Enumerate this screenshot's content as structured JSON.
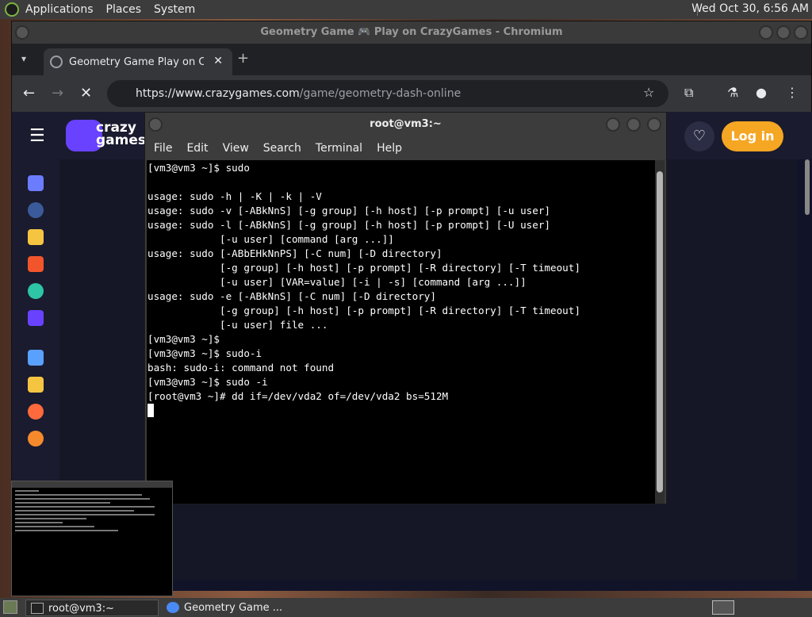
{
  "top_panel": {
    "menus": [
      "Applications",
      "Places",
      "System"
    ],
    "clock": "Wed Oct 30,  6:56 AM"
  },
  "browser": {
    "window_title": "Geometry Game 🎮 Play on CrazyGames - Chromium",
    "tab_title": "Geometry Game   Play on Cr",
    "tab_close": "✕",
    "new_tab": "+",
    "url_host": "https://www.crazygames.com",
    "url_path": "/game/geometry-dash-online",
    "site": {
      "logo_text_1": "crazy",
      "logo_text_2": "games",
      "login_label": "Log in"
    }
  },
  "terminal": {
    "title": "root@vm3:~",
    "menu": [
      "File",
      "Edit",
      "View",
      "Search",
      "Terminal",
      "Help"
    ],
    "lines": [
      "[vm3@vm3 ~]$ sudo",
      "",
      "usage: sudo -h | -K | -k | -V",
      "usage: sudo -v [-ABkNnS] [-g group] [-h host] [-p prompt] [-u user]",
      "usage: sudo -l [-ABkNnS] [-g group] [-h host] [-p prompt] [-U user]",
      "            [-u user] [command [arg ...]]",
      "usage: sudo [-ABbEHkNnPS] [-C num] [-D directory]",
      "            [-g group] [-h host] [-p prompt] [-R directory] [-T timeout]",
      "            [-u user] [VAR=value] [-i | -s] [command [arg ...]]",
      "usage: sudo -e [-ABkNnS] [-C num] [-D directory]",
      "            [-g group] [-h host] [-p prompt] [-R directory] [-T timeout]",
      "            [-u user] file ...",
      "[vm3@vm3 ~]$",
      "[vm3@vm3 ~]$ sudo-i",
      "bash: sudo-i: command not found",
      "[vm3@vm3 ~]$ sudo -i",
      "[root@vm3 ~]# dd if=/dev/vda2 of=/dev/vda2 bs=512M"
    ]
  },
  "taskbar": {
    "tasks": [
      "root@vm3:~",
      "Geometry Game ..."
    ]
  }
}
